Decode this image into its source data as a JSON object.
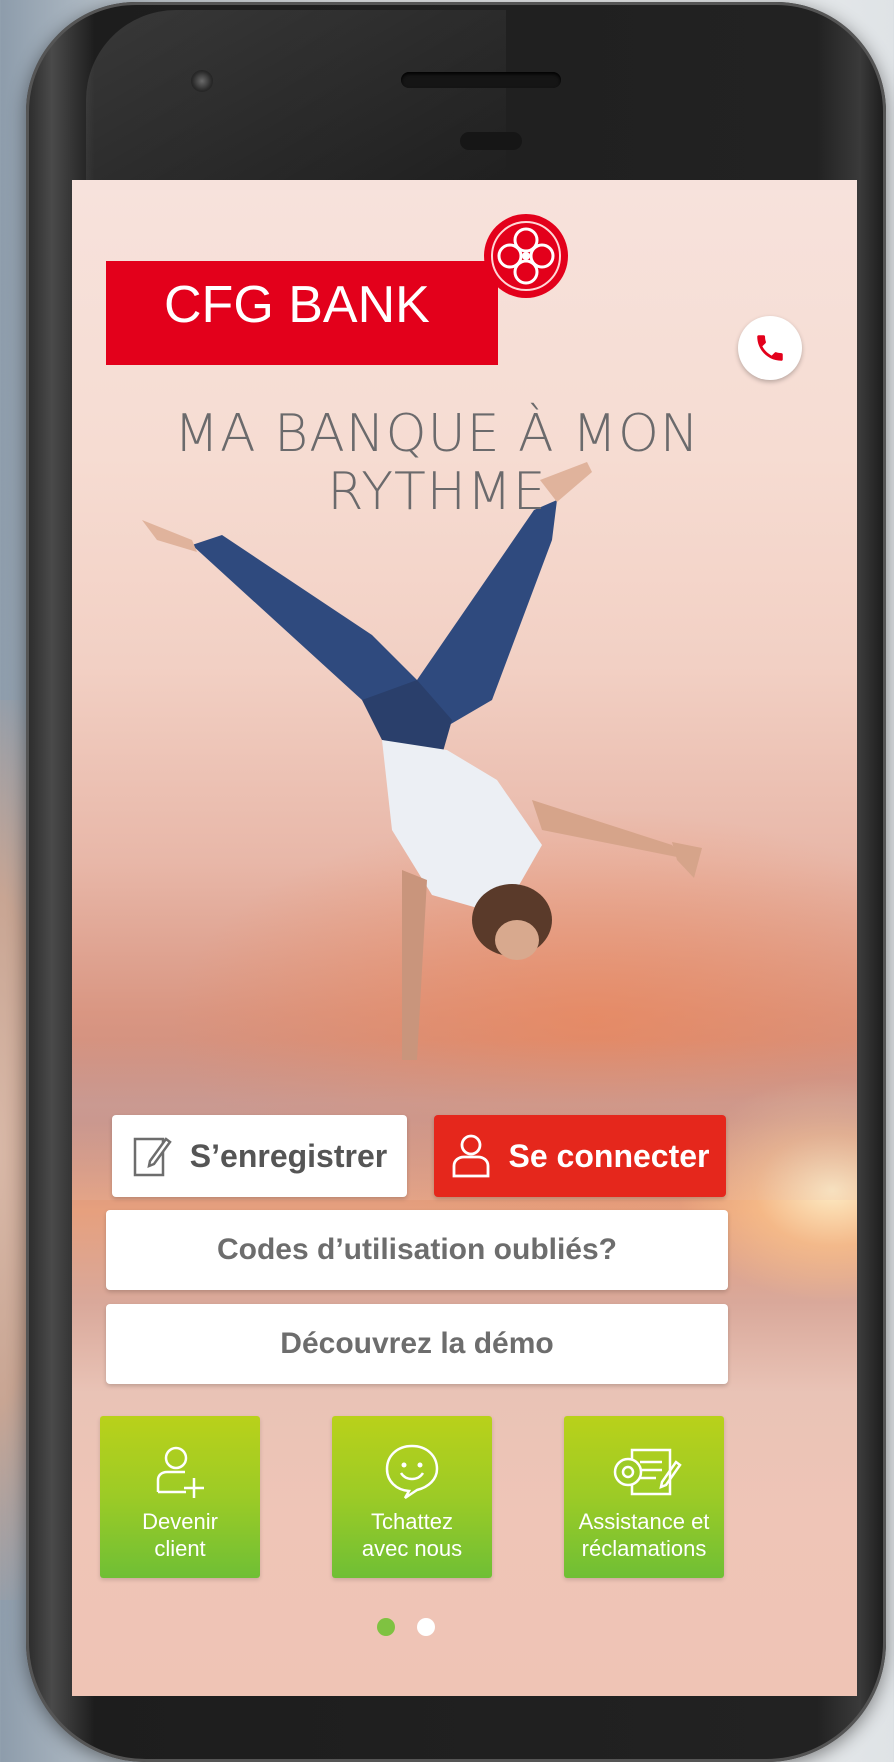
{
  "brand": {
    "name": "CFG BANK",
    "color": "#e3001b"
  },
  "header": {
    "call_icon": "phone-icon"
  },
  "hero": {
    "tagline_line1": "MA BANQUE À MON",
    "tagline_line2": "RYTHME"
  },
  "actions": {
    "register_label": "S’enregistrer",
    "login_label": "Se connecter",
    "forgot_label": "Codes d’utilisation oubliés?",
    "demo_label": "Découvrez la démo"
  },
  "tiles": [
    {
      "line1": "Devenir",
      "line2": "client",
      "icon": "add-user-icon"
    },
    {
      "line1": "Tchattez",
      "line2": "avec nous",
      "icon": "chat-smiley-icon"
    },
    {
      "line1": "Assistance et",
      "line2": "réclamations",
      "icon": "settings-document-icon"
    }
  ],
  "pager": {
    "active_index": 0,
    "count": 2,
    "active_color": "#7fc241"
  },
  "colors": {
    "accent_red": "#e5271c",
    "tile_green": "#9ccb26"
  }
}
